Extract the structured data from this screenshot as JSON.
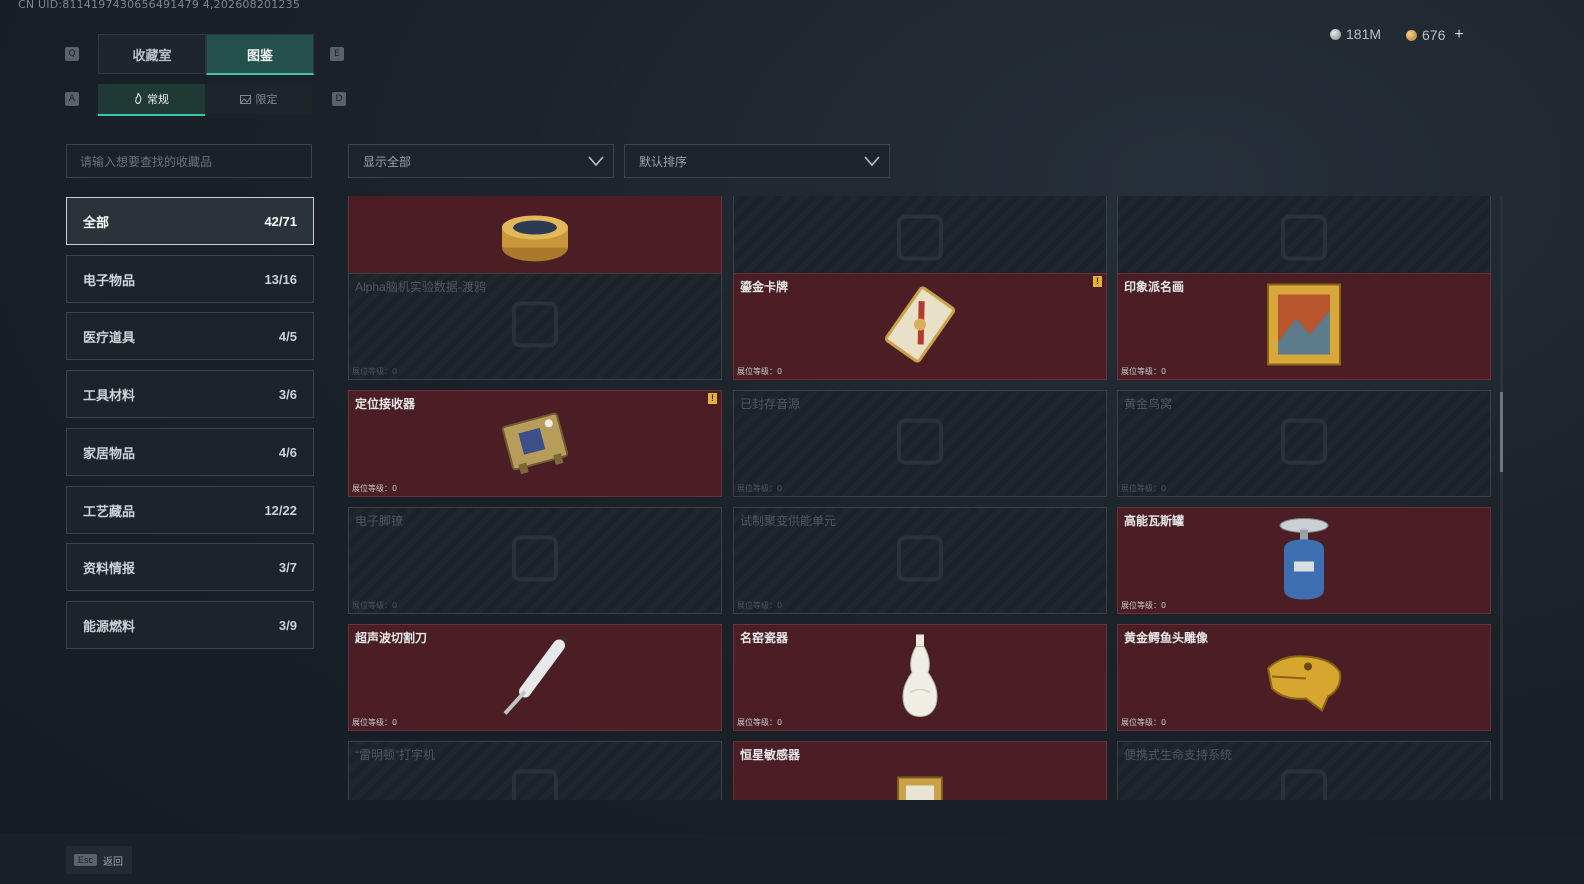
{
  "uid": "CN UID:8114197430656491479 4,202608201235",
  "currency": {
    "silver": "181M",
    "gold": "676",
    "add": "+"
  },
  "keys": {
    "tab_prev": "Q",
    "tab_next": "E",
    "sub_prev": "A",
    "sub_next": "D"
  },
  "tabs": [
    {
      "label": "收藏室"
    },
    {
      "label": "图鉴"
    }
  ],
  "subtabs": [
    {
      "label": "常规"
    },
    {
      "label": "限定"
    }
  ],
  "search": {
    "placeholder": "请输入想要查找的收藏品"
  },
  "filter": {
    "label": "显示全部"
  },
  "sort": {
    "label": "默认排序"
  },
  "categories": [
    {
      "label": "全部",
      "count": "42/71"
    },
    {
      "label": "电子物品",
      "count": "13/16"
    },
    {
      "label": "医疗道具",
      "count": "4/5"
    },
    {
      "label": "工具材料",
      "count": "3/6"
    },
    {
      "label": "家居物品",
      "count": "4/6"
    },
    {
      "label": "工艺藏品",
      "count": "12/22"
    },
    {
      "label": "资料情报",
      "count": "3/7"
    },
    {
      "label": "能源燃料",
      "count": "3/9"
    }
  ],
  "level_label": "展位等级：0",
  "items": [
    {
      "name": "",
      "owned": true,
      "icon": "caviar-tin-icon"
    },
    {
      "name": "",
      "owned": false,
      "icon": "locked-item-icon"
    },
    {
      "name": "",
      "owned": false,
      "icon": "locked-item-icon"
    },
    {
      "name": "Alpha脑机实验数据-渡鸦",
      "owned": false,
      "icon": "data-device-icon"
    },
    {
      "name": "鎏金卡牌",
      "owned": true,
      "icon": "gilded-card-icon",
      "badge": "!"
    },
    {
      "name": "印象派名画",
      "owned": true,
      "icon": "framed-painting-icon"
    },
    {
      "name": "定位接收器",
      "owned": true,
      "icon": "gps-receiver-icon",
      "badge": "!"
    },
    {
      "name": "已封存音源",
      "owned": false,
      "icon": "sealed-audio-icon"
    },
    {
      "name": "黄金鸟窝",
      "owned": false,
      "icon": "golden-nest-icon"
    },
    {
      "name": "电子脚镣",
      "owned": false,
      "icon": "ankle-monitor-icon"
    },
    {
      "name": "试制聚变供能单元",
      "owned": false,
      "icon": "fusion-cell-icon"
    },
    {
      "name": "高能瓦斯罐",
      "owned": true,
      "icon": "gas-canister-icon"
    },
    {
      "name": "超声波切割刀",
      "owned": true,
      "icon": "ultrasonic-knife-icon"
    },
    {
      "name": "名窑瓷器",
      "owned": true,
      "icon": "porcelain-vase-icon"
    },
    {
      "name": "黄金鳄鱼头雕像",
      "owned": true,
      "icon": "golden-crocodile-icon"
    },
    {
      "name": "“雷明顿”打字机",
      "owned": false,
      "icon": "typewriter-icon"
    },
    {
      "name": "恒星敏感器",
      "owned": true,
      "icon": "star-sensor-icon"
    },
    {
      "name": "便携式生命支持系统",
      "owned": false,
      "icon": "life-support-icon"
    }
  ],
  "esc": {
    "key": "Esc",
    "label": "返回"
  }
}
